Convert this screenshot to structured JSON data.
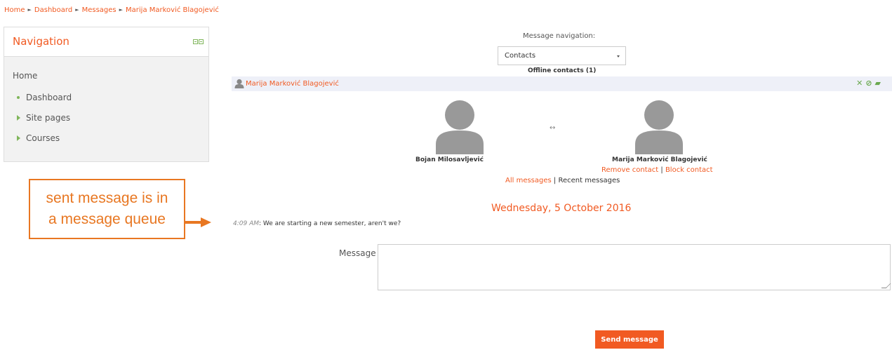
{
  "breadcrumb": {
    "items": [
      "Home",
      "Dashboard",
      "Messages",
      "Marija Marković Blagojević"
    ],
    "separator": "►"
  },
  "navigation": {
    "title": "Navigation",
    "home": "Home",
    "items": [
      {
        "label": "Dashboard",
        "icon": "bullet-icon"
      },
      {
        "label": "Site pages",
        "icon": "expand-arrow-icon"
      },
      {
        "label": "Courses",
        "icon": "expand-arrow-icon"
      }
    ]
  },
  "annotation": {
    "line1": "sent message is in",
    "line2": "a message queue"
  },
  "message_navigation": {
    "label": "Message navigation:",
    "selected": "Contacts",
    "section_title": "Offline contacts (1)"
  },
  "contact_bar": {
    "name": "Marija Marković Blagojević",
    "icons": [
      "remove-icon",
      "block-icon",
      "message-icon"
    ]
  },
  "conversation": {
    "user_left": "Bojan Milosavljević",
    "user_right": "Marija Marković Blagojević",
    "swap_symbol": "↔",
    "remove_contact": "Remove contact",
    "block_contact": "Block contact",
    "link_separator": "|",
    "all_messages": "All messages",
    "recent_messages": "Recent messages",
    "date": "Wednesday, 5 October 2016",
    "message_time": "4:09 AM",
    "message_text": ": We are starting a new semester, aren't we?"
  },
  "compose": {
    "label": "Message",
    "value": "",
    "send_label": "Send message"
  },
  "colors": {
    "accent": "#f15a22",
    "callout": "#e87722",
    "green_icon": "#6aa84f"
  }
}
